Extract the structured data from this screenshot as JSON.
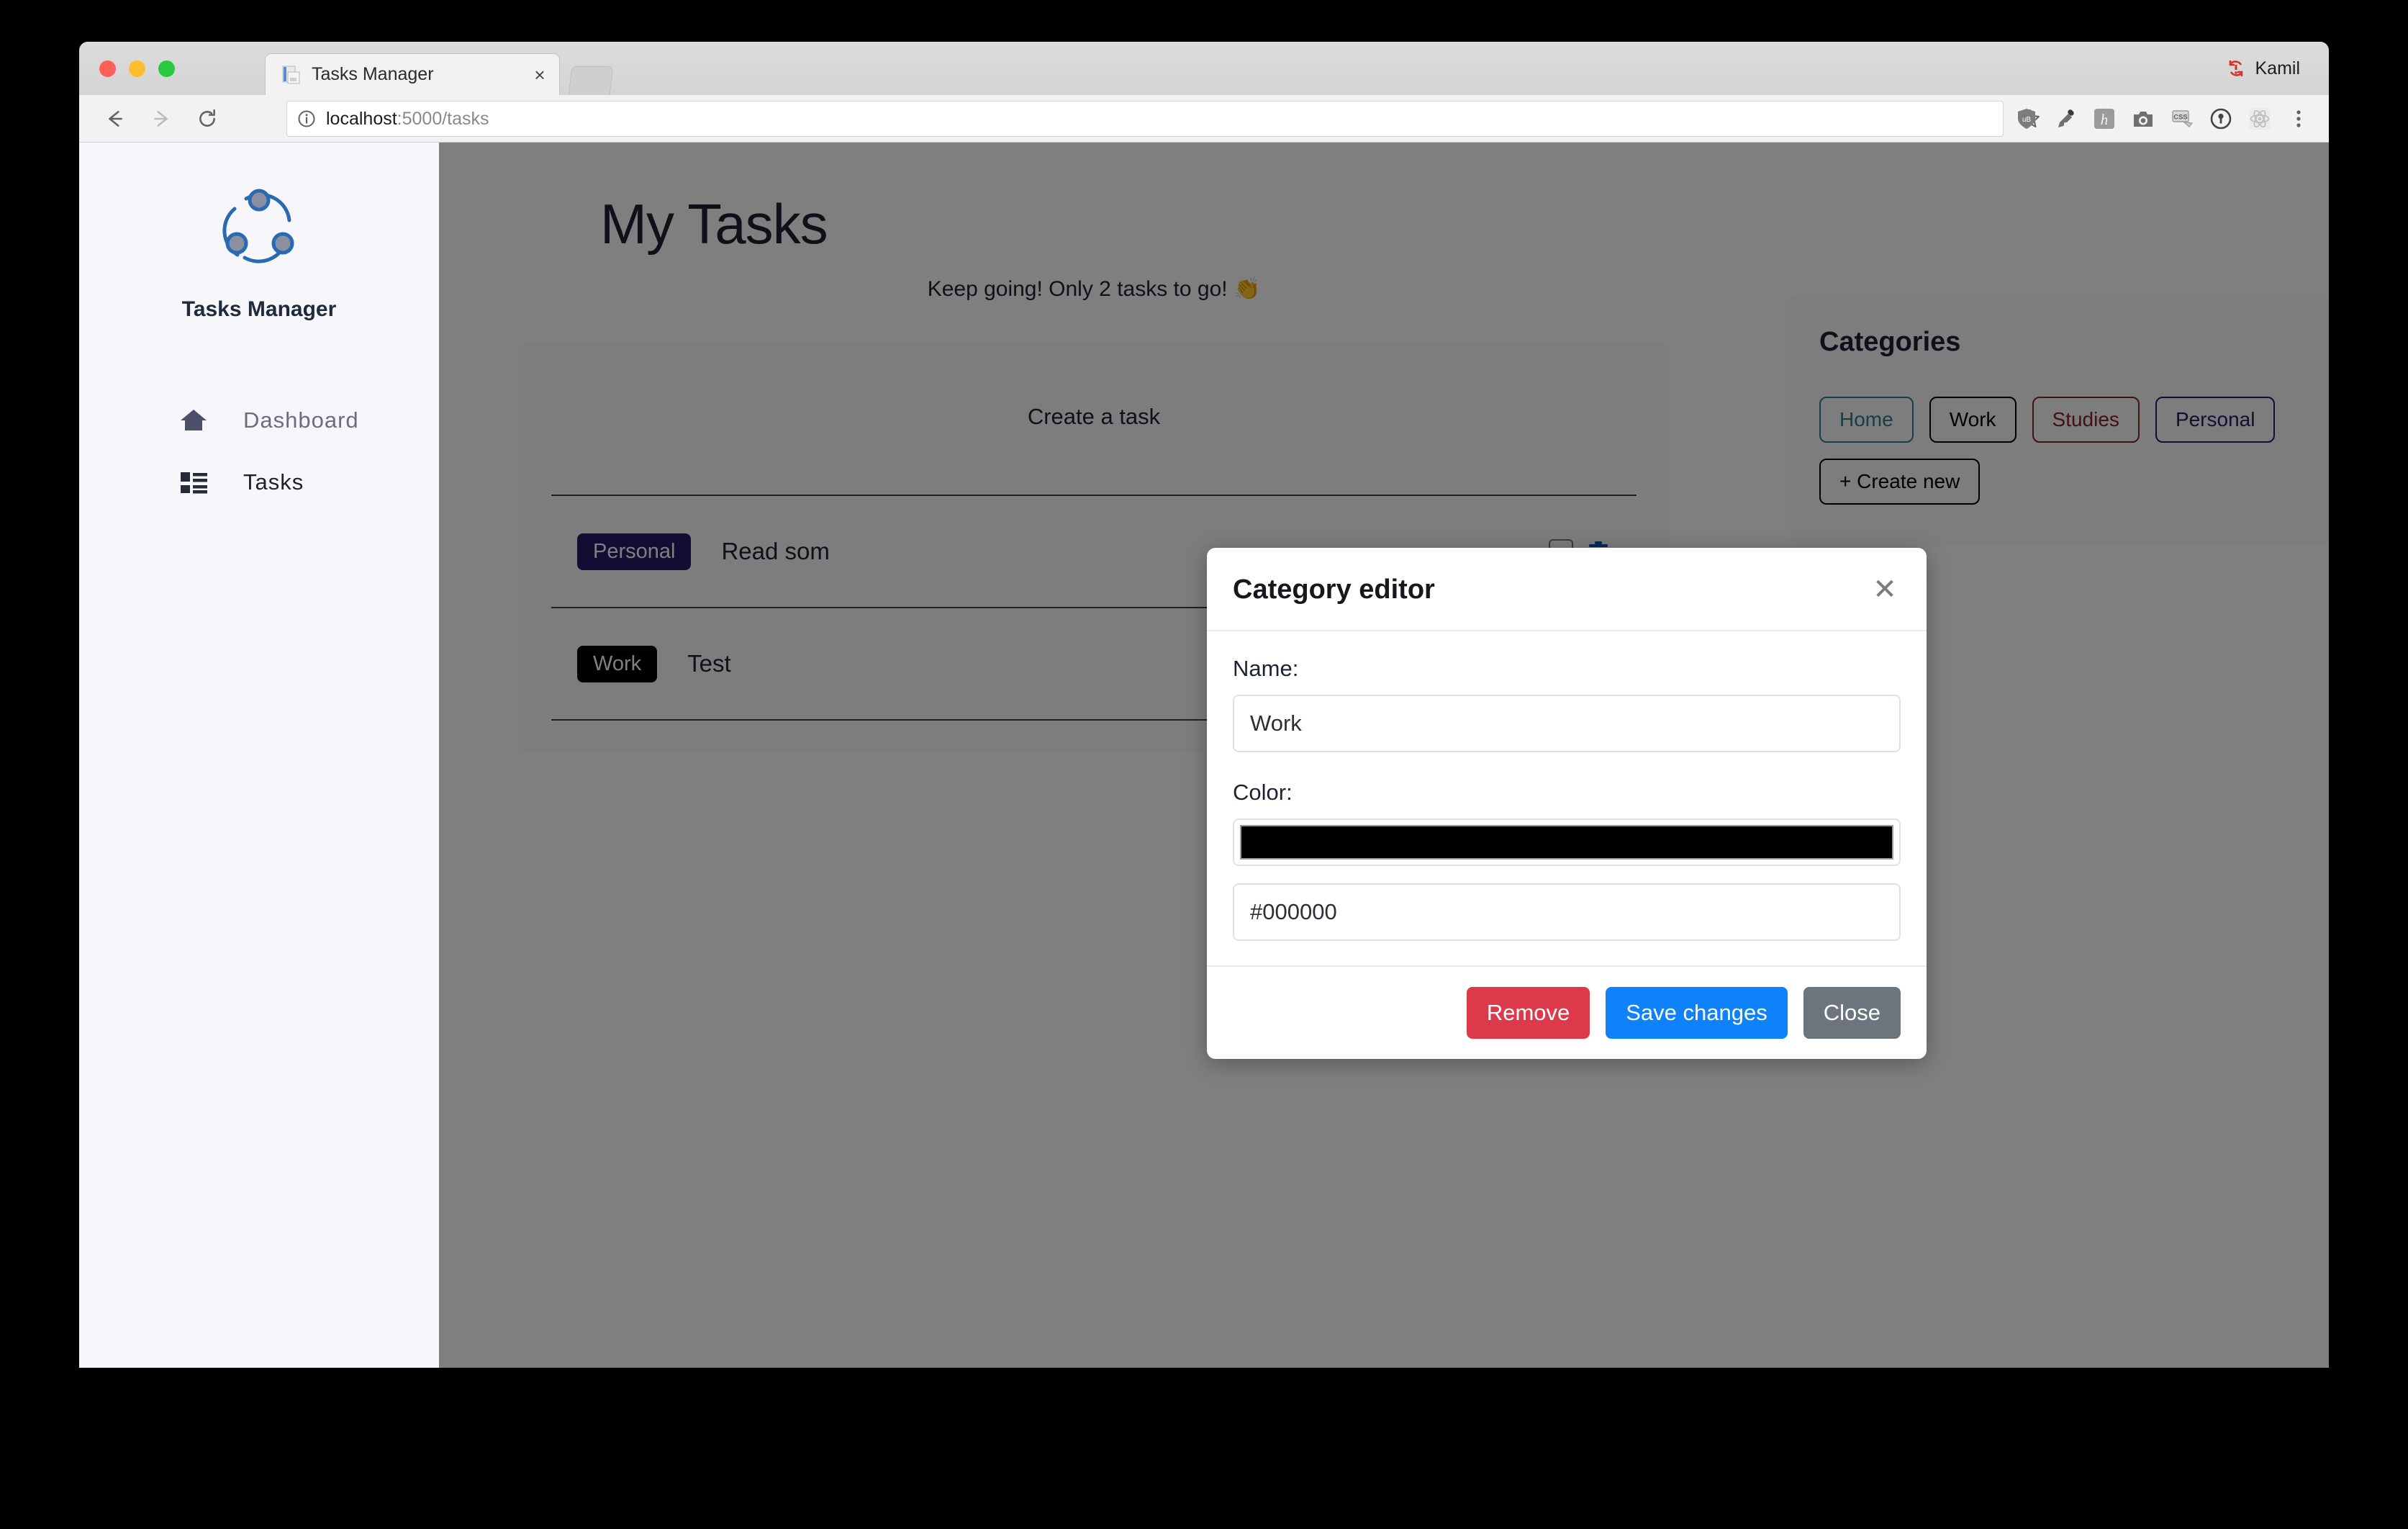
{
  "browser": {
    "tab": {
      "title": "Tasks Manager",
      "favicon": "document-icon",
      "close_label": "×"
    },
    "profile": {
      "name": "Kamil",
      "status_icon": "sync-error-icon"
    },
    "toolbar": {
      "back_icon": "arrow-left-icon",
      "forward_icon": "arrow-right-icon",
      "reload_icon": "reload-icon",
      "info_icon": "info-circle-icon",
      "url_host": "localhost",
      "url_rest": ":5000/tasks",
      "url_full": "localhost:5000/tasks",
      "bookmark_icon": "star-icon",
      "extensions": [
        {
          "name": "ublock-origin-icon",
          "label": "uB"
        },
        {
          "name": "eyedropper-icon",
          "label": ""
        },
        {
          "name": "hypothesis-icon",
          "label": "h"
        },
        {
          "name": "screenshot-camera-icon",
          "label": ""
        },
        {
          "name": "css-tool-icon",
          "label": "CSS"
        },
        {
          "name": "password-key-icon",
          "label": ""
        },
        {
          "name": "react-devtools-icon",
          "label": ""
        },
        {
          "name": "browser-menu-icon",
          "label": "⋮"
        }
      ]
    }
  },
  "sidebar": {
    "brand": {
      "logo_icon": "tasks-cycle-logo-icon",
      "name": "Tasks Manager"
    },
    "items": [
      {
        "label": "Dashboard",
        "icon": "home-icon"
      },
      {
        "label": "Tasks",
        "icon": "list-icon"
      }
    ]
  },
  "main": {
    "page_title": "My Tasks",
    "encouragement": "Keep going! Only 2 tasks to go! 👏",
    "create_task_label": "Create a task",
    "tasks": [
      {
        "category": "Personal",
        "category_color": "#221b66",
        "title": "Read som",
        "checkbox_icon": "checkbox-unchecked-icon",
        "delete_icon": "trash-icon"
      },
      {
        "category": "Work",
        "category_color": "#000000",
        "title": "Test",
        "checkbox_icon": "checkbox-unchecked-icon",
        "delete_icon": "trash-icon"
      }
    ]
  },
  "categories_panel": {
    "title": "Categories",
    "chips": [
      {
        "label": "Home",
        "color": "#2e7f8a"
      },
      {
        "label": "Work",
        "color": "#000000"
      },
      {
        "label": "Studies",
        "color": "#8a2020"
      },
      {
        "label": "Personal",
        "color": "#221b66"
      },
      {
        "label": "+ Create new",
        "color": "#000000"
      }
    ]
  },
  "modal": {
    "title": "Category editor",
    "close_icon_label": "✕",
    "name_label": "Name:",
    "name_value": "Work",
    "color_label": "Color:",
    "color_swatch_value": "#000000",
    "color_hex_value": "#000000",
    "buttons": {
      "remove": "Remove",
      "save": "Save changes",
      "close": "Close"
    }
  }
}
